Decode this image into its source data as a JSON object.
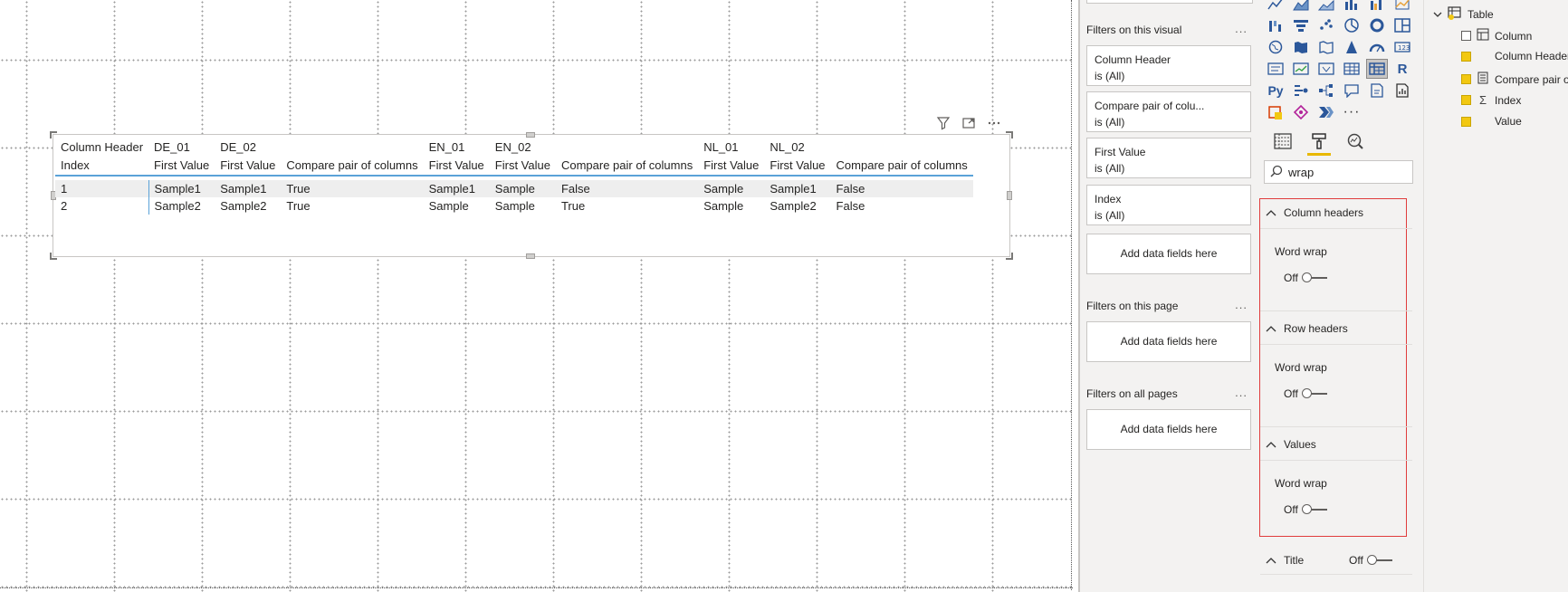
{
  "visual": {
    "toolbar_icons": [
      "filter-icon",
      "focus-mode-icon",
      "more-options-icon"
    ],
    "table": {
      "header_row_1": [
        "Column Header",
        "DE_01",
        "DE_02",
        "",
        "EN_01",
        "EN_02",
        "",
        "NL_01",
        "NL_02",
        ""
      ],
      "header_row_2": [
        "Index",
        "First Value",
        "First Value",
        "Compare pair of columns",
        "First Value",
        "First Value",
        "Compare pair of columns",
        "First Value",
        "First Value",
        "Compare pair of columns"
      ],
      "rows": [
        [
          "1",
          "Sample1",
          "Sample1",
          "True",
          "Sample1",
          "Sample",
          "False",
          "Sample",
          "Sample1",
          "False"
        ],
        [
          "2",
          "Sample2",
          "Sample2",
          "True",
          "Sample",
          "Sample",
          "True",
          "Sample",
          "Sample2",
          "False"
        ]
      ]
    }
  },
  "filters": {
    "visual_title": "Filters on this visual",
    "more": "...",
    "cards": [
      {
        "name": "Column Header",
        "state": "is (All)"
      },
      {
        "name": "Compare pair of colu...",
        "state": "is (All)"
      },
      {
        "name": "First Value",
        "state": "is (All)"
      },
      {
        "name": "Index",
        "state": "is (All)"
      }
    ],
    "add_fields": "Add data fields here",
    "page_title": "Filters on this page",
    "all_pages_title": "Filters on all pages"
  },
  "viz": {
    "search_value": "wrap",
    "sections": [
      {
        "title": "Column headers",
        "option": "Word wrap",
        "toggle": "Off"
      },
      {
        "title": "Row headers",
        "option": "Word wrap",
        "toggle": "Off"
      },
      {
        "title": "Values",
        "option": "Word wrap",
        "toggle": "Off"
      }
    ],
    "title_section": {
      "title": "Title",
      "toggle": "Off"
    }
  },
  "fields": {
    "table_name": "Table",
    "items": [
      {
        "label": "Column",
        "checked": false,
        "icon": "hierarchy-icon"
      },
      {
        "label": "Column Header",
        "checked": true,
        "icon": ""
      },
      {
        "label": "Compare pair o",
        "checked": true,
        "icon": "calculated-column-icon"
      },
      {
        "label": "Index",
        "checked": true,
        "icon": "sigma-icon"
      },
      {
        "label": "Value",
        "checked": true,
        "icon": ""
      }
    ]
  },
  "colors": {
    "accent_blue": "#5aa2d8",
    "highlight_red": "#e03c3c",
    "checkbox_yellow": "#f2c811"
  }
}
